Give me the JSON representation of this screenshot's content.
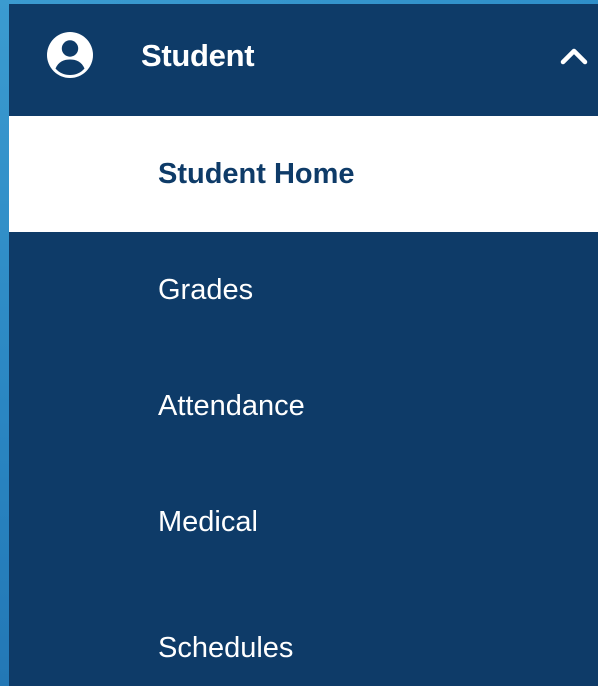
{
  "colors": {
    "nav_background": "#0e3b68",
    "active_background": "#ffffff",
    "active_text": "#0e3b68",
    "text": "#ffffff",
    "edge_accent": "#2f8fc9"
  },
  "section": {
    "icon": "user-circle-icon",
    "label": "Student",
    "expanded": true,
    "toggle_icon": "chevron-up-icon"
  },
  "menu": {
    "items": [
      {
        "label": "Student Home",
        "active": true
      },
      {
        "label": "Grades",
        "active": false
      },
      {
        "label": "Attendance",
        "active": false
      },
      {
        "label": "Medical",
        "active": false
      },
      {
        "label": "Schedules",
        "active": false
      }
    ]
  }
}
